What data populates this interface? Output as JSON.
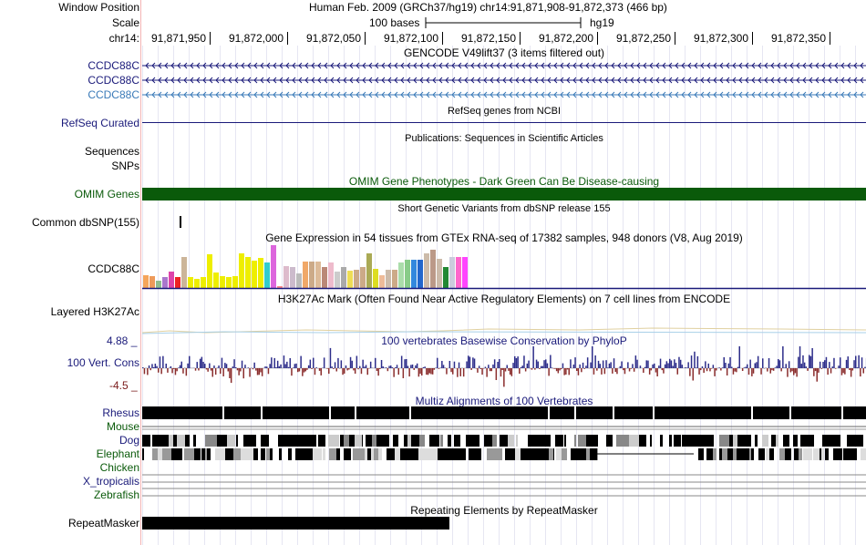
{
  "window_position": {
    "label": "Window Position",
    "value": "Human Feb. 2009 (GRCh37/hg19)   chr14:91,871,908-91,872,373 (466 bp)"
  },
  "scale": {
    "label": "Scale",
    "bar_text": "100 bases",
    "assembly": "hg19"
  },
  "ruler": {
    "label": "chr14:",
    "ticks": [
      "91,871,950",
      "91,872,000",
      "91,872,050",
      "91,872,100",
      "91,872,150",
      "91,872,200",
      "91,872,250",
      "91,872,300",
      "91,872,350"
    ]
  },
  "gencode": {
    "title": "GENCODE V49lift37 (3 items filtered out)",
    "items": [
      "CCDC88C",
      "CCDC88C",
      "CCDC88C"
    ]
  },
  "refseq": {
    "label": "RefSeq Curated",
    "title": "RefSeq genes from NCBI"
  },
  "publications": {
    "title": "Publications: Sequences in Scientific Articles",
    "labels": [
      "Sequences",
      "SNPs"
    ]
  },
  "omim": {
    "label": "OMIM Genes",
    "title": "OMIM Gene Phenotypes - Dark Green Can Be Disease-causing"
  },
  "dbsnp": {
    "label": "Common dbSNP(155)",
    "title": "Short Genetic Variants from dbSNP release 155"
  },
  "gtex": {
    "label": "CCDC88C",
    "title": "Gene Expression in 54 tissues from GTEx RNA-seq of 17382 samples, 948 donors (V8, Aug 2019)",
    "bars": [
      {
        "v": 0.3,
        "c": "#f5a55a"
      },
      {
        "v": 0.28,
        "c": "#ee9a5a"
      },
      {
        "v": 0.16,
        "c": "#8fbc8f"
      },
      {
        "v": 0.26,
        "c": "#aa77cc"
      },
      {
        "v": 0.38,
        "c": "#dd44aa"
      },
      {
        "v": 0.26,
        "c": "#ee2222"
      },
      {
        "v": 0.73,
        "c": "#ccb599"
      },
      {
        "v": 0.25,
        "c": "#eeee00"
      },
      {
        "v": 0.22,
        "c": "#eeee00"
      },
      {
        "v": 0.25,
        "c": "#eeee00"
      },
      {
        "v": 0.78,
        "c": "#eeee00"
      },
      {
        "v": 0.36,
        "c": "#eeee00"
      },
      {
        "v": 0.28,
        "c": "#eeee00"
      },
      {
        "v": 0.26,
        "c": "#eeee00"
      },
      {
        "v": 0.28,
        "c": "#eeee00"
      },
      {
        "v": 0.8,
        "c": "#eeee00"
      },
      {
        "v": 0.73,
        "c": "#eeee00"
      },
      {
        "v": 0.64,
        "c": "#eeee00"
      },
      {
        "v": 0.7,
        "c": "#eeee00"
      },
      {
        "v": 0.6,
        "c": "#33cccc"
      },
      {
        "v": 1.0,
        "c": "#dd66dd"
      },
      {
        "v": 0.05,
        "c": "#ff8888"
      },
      {
        "v": 0.5,
        "c": "#ddbbcc"
      },
      {
        "v": 0.48,
        "c": "#ccbbcc"
      },
      {
        "v": 0.35,
        "c": "#bbbbbb"
      },
      {
        "v": 0.62,
        "c": "#f0a868"
      },
      {
        "v": 0.62,
        "c": "#ccaa88"
      },
      {
        "v": 0.62,
        "c": "#ddbb99"
      },
      {
        "v": 0.48,
        "c": "#bb8877"
      },
      {
        "v": 0.6,
        "c": "#eebbcc"
      },
      {
        "v": 0.38,
        "c": "#cccccc"
      },
      {
        "v": 0.48,
        "c": "#aaaaaa"
      },
      {
        "v": 0.4,
        "c": "#eedd55"
      },
      {
        "v": 0.42,
        "c": "#ccaa88"
      },
      {
        "v": 0.48,
        "c": "#ccaa88"
      },
      {
        "v": 0.8,
        "c": "#aaaa55"
      },
      {
        "v": 0.45,
        "c": "#dddd22"
      },
      {
        "v": 0.3,
        "c": "#eebb99"
      },
      {
        "v": 0.42,
        "c": "#ccbbaa"
      },
      {
        "v": 0.42,
        "c": "#ccaa88"
      },
      {
        "v": 0.6,
        "c": "#aaddaa"
      },
      {
        "v": 0.65,
        "c": "#88cc88"
      },
      {
        "v": 0.65,
        "c": "#3388dd"
      },
      {
        "v": 0.65,
        "c": "#2266cc"
      },
      {
        "v": 0.8,
        "c": "#ccbbaa"
      },
      {
        "v": 0.9,
        "c": "#bb9988"
      },
      {
        "v": 0.68,
        "c": "#ccbbaa"
      },
      {
        "v": 0.48,
        "c": "#228833"
      },
      {
        "v": 0.72,
        "c": "#ccccdd"
      },
      {
        "v": 0.72,
        "c": "#ff66cc"
      },
      {
        "v": 0.72,
        "c": "#ff44ff"
      }
    ]
  },
  "h3k27ac": {
    "label": "Layered H3K27Ac",
    "title": "H3K27Ac Mark (Often Found Near Active Regulatory Elements) on 7 cell lines from ENCODE"
  },
  "conservation": {
    "label": "100 Vert. Cons",
    "title": "100 vertebrates Basewise Conservation by PhyloP",
    "max": "4.88 _",
    "min": "-4.5 _"
  },
  "multiz": {
    "title": "Multiz Alignments of 100 Vertebrates",
    "species": [
      {
        "name": "Rhesus",
        "color": "#1a1a7a"
      },
      {
        "name": "Mouse",
        "color": "#0a5a0a"
      },
      {
        "name": "Dog",
        "color": "#1a1a7a"
      },
      {
        "name": "Elephant",
        "color": "#0a5a0a"
      },
      {
        "name": "Chicken",
        "color": "#0a5a0a"
      },
      {
        "name": "X_tropicalis",
        "color": "#1a1a7a"
      },
      {
        "name": "Zebrafish",
        "color": "#0a5a0a"
      }
    ]
  },
  "repeatmasker": {
    "label": "RepeatMasker",
    "title": "Repeating Elements by RepeatMasker"
  },
  "colors": {
    "navy": "#1a1a7a",
    "omim_green": "#0a5a0a",
    "cons_pos": "#2d2d8a",
    "cons_neg": "#8a2d2d"
  }
}
